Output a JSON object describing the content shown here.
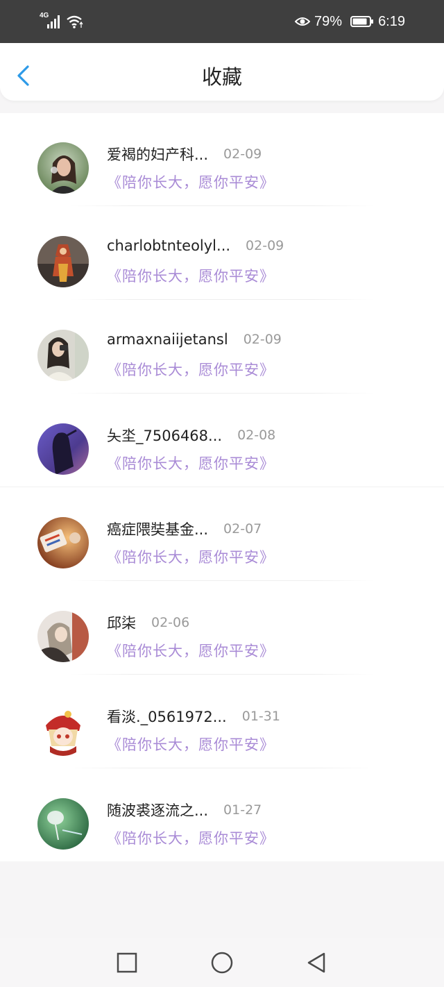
{
  "status_bar": {
    "network": "4G",
    "battery": "79%",
    "time": "6:19",
    "icons": [
      "signal-icon",
      "wifi-icon",
      "eye-icon",
      "battery-icon"
    ]
  },
  "header": {
    "title": "收藏",
    "back_icon": "chevron-left-icon"
  },
  "colors": {
    "accent": "#2d9ae8",
    "subtitle": "#a98bd6",
    "status_bar": "#3f3f3f"
  },
  "items": [
    {
      "name": "爱褐的妇产科...",
      "date": "02-09",
      "subtitle": "《陪你长大，愿你平安》"
    },
    {
      "name": "charlobtnteolyl...",
      "date": "02-09",
      "subtitle": "《陪你长大，愿你平安》"
    },
    {
      "name": "armaxnaiijetansl",
      "date": "02-09",
      "subtitle": "《陪你长大，愿你平安》"
    },
    {
      "name": "夨坔_7506468...",
      "date": "02-08",
      "subtitle": "《陪你长大，愿你平安》"
    },
    {
      "name": "癌症隈奘基金...",
      "date": "02-07",
      "subtitle": "《陪你长大，愿你平安》"
    },
    {
      "name": "邱柒",
      "date": "02-06",
      "subtitle": "《陪你长大，愿你平安》"
    },
    {
      "name": "看淡._0561972...",
      "date": "01-31",
      "subtitle": "《陪你长大，愿你平安》"
    },
    {
      "name": "随波裘逐流之...",
      "date": "01-27",
      "subtitle": "《陪你长大，愿你平安》"
    }
  ],
  "nav": [
    "recent-apps-icon",
    "home-icon",
    "back-icon"
  ]
}
